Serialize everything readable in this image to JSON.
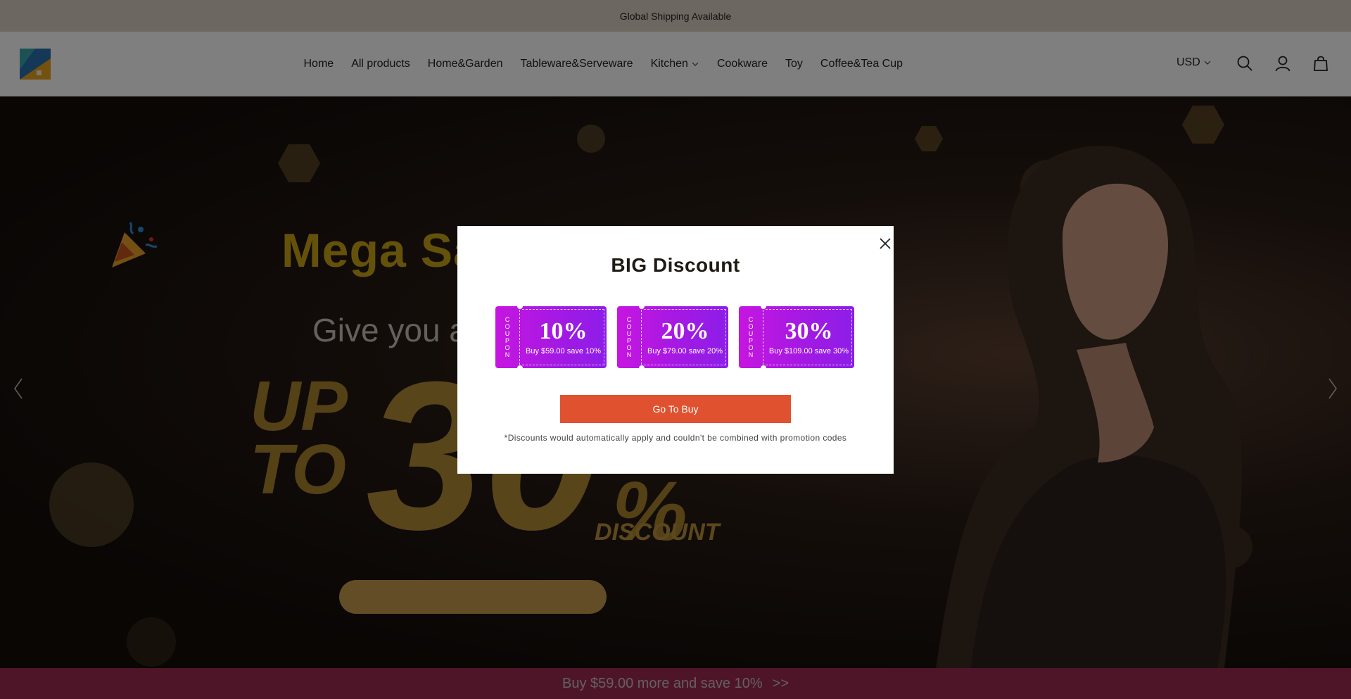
{
  "announcement": "Global Shipping Available",
  "nav": {
    "items": [
      {
        "label": "Home",
        "dropdown": false
      },
      {
        "label": "All products",
        "dropdown": false
      },
      {
        "label": "Home&Garden",
        "dropdown": false
      },
      {
        "label": "Tableware&Serveware",
        "dropdown": false
      },
      {
        "label": "Kitchen",
        "dropdown": true
      },
      {
        "label": "Cookware",
        "dropdown": false
      },
      {
        "label": "Toy",
        "dropdown": false
      },
      {
        "label": "Coffee&Tea Cup",
        "dropdown": false
      }
    ],
    "currency": "USD",
    "icons": [
      "search-icon",
      "account-icon",
      "cart-icon"
    ]
  },
  "hero": {
    "headline": "Mega Sa",
    "subline": "Give you a",
    "promo_up": "UP",
    "promo_to": "TO",
    "promo_value": "30",
    "promo_percent": "%",
    "promo_word": "DISCOUNT"
  },
  "modal": {
    "title": "BIG Discount",
    "coupon_side_label": "COUPON",
    "coupons": [
      {
        "percent": "10%",
        "condition": "Buy $59.00 save 10%"
      },
      {
        "percent": "20%",
        "condition": "Buy $79.00 save 20%"
      },
      {
        "percent": "30%",
        "condition": "Buy $109.00 save 30%"
      }
    ],
    "button": "Go To Buy",
    "note": "*Discounts would automatically apply and couldn't be combined with promotion codes"
  },
  "bottom_bar": {
    "text": "Buy $59.00 more and save 10%",
    "arrow": ">>"
  },
  "colors": {
    "accent": "#e0522f",
    "coupon_start": "#c616e0",
    "coupon_end": "#8c1ee8",
    "bottom_bar": "#9c2a52"
  }
}
